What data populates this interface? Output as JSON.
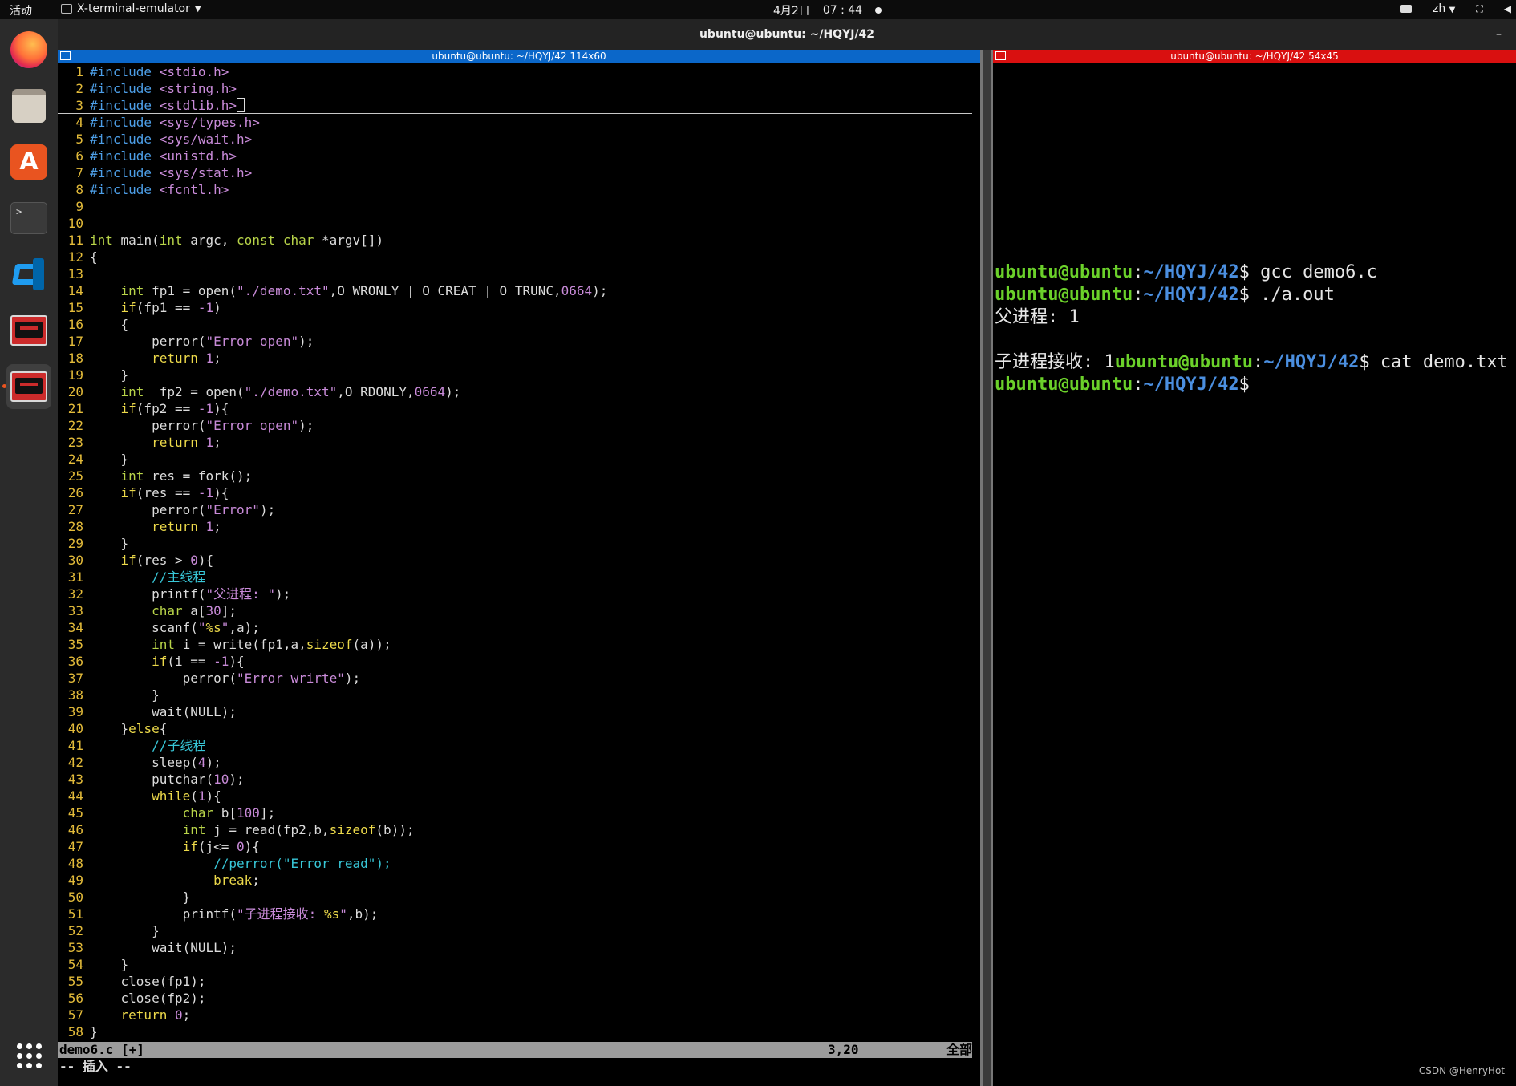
{
  "topbar": {
    "activities": "活动",
    "app_name": "X-terminal-emulator",
    "date": "4月2日",
    "time": "07 : 44",
    "input_method": "zh"
  },
  "dock": {
    "items": [
      {
        "name": "firefox-icon"
      },
      {
        "name": "files-icon"
      },
      {
        "name": "app-store-icon"
      },
      {
        "name": "terminal-icon"
      },
      {
        "name": "vscode-icon"
      },
      {
        "name": "xterm-icon"
      },
      {
        "name": "xterm-active-icon"
      }
    ],
    "show_apps_icon": "grid-icon"
  },
  "window": {
    "title": "ubuntu@ubuntu: ~/HQYJ/42",
    "minimize_glyph": "–"
  },
  "left_pane": {
    "title": "ubuntu@ubuntu: ~/HQYJ/42 114x60",
    "cursor_line": 3,
    "status": {
      "file": "demo6.c [+]",
      "position": "3,20",
      "percent": "全部"
    },
    "mode": "-- 插入 --"
  },
  "right_pane": {
    "title": "ubuntu@ubuntu: ~/HQYJ/42 54x45",
    "lines": [
      {
        "user": "ubuntu@ubuntu",
        "sep": ":",
        "path": "~/HQYJ/42",
        "prompt": "$ gcc demo6.c"
      },
      {
        "user": "ubuntu@ubuntu",
        "sep": ":",
        "path": "~/HQYJ/42",
        "prompt": "$ ./a.out"
      },
      {
        "plain": "父进程: 1"
      },
      {
        "plain": ""
      },
      {
        "prefix": "子进程接收: 1",
        "user": "ubuntu@ubuntu",
        "sep": ":",
        "path": "~/HQYJ/42",
        "prompt": "$ cat demo.txt"
      },
      {
        "user": "ubuntu@ubuntu",
        "sep": ":",
        "path": "~/HQYJ/42",
        "prompt": "$"
      }
    ]
  },
  "watermark": "CSDN @HenryHot",
  "colors": {
    "line_number": "#e3bb3a",
    "preproc": "#4d9fe8",
    "string": "#c98bd9",
    "number": "#c98bd9",
    "keyword": "#ecd94a",
    "comment": "#38c7d8",
    "type": "#b8d449",
    "plain": "#dcdcdc"
  },
  "code": [
    [
      [
        "p",
        "#include "
      ],
      [
        "s",
        "<stdio.h>"
      ]
    ],
    [
      [
        "p",
        "#include "
      ],
      [
        "s",
        "<string.h>"
      ]
    ],
    [
      [
        "p",
        "#include "
      ],
      [
        "s",
        "<stdlib.h>"
      ]
    ],
    [
      [
        "p",
        "#include "
      ],
      [
        "s",
        "<sys/types.h>"
      ]
    ],
    [
      [
        "p",
        "#include "
      ],
      [
        "s",
        "<sys/wait.h>"
      ]
    ],
    [
      [
        "p",
        "#include "
      ],
      [
        "s",
        "<unistd.h>"
      ]
    ],
    [
      [
        "p",
        "#include "
      ],
      [
        "s",
        "<sys/stat.h>"
      ]
    ],
    [
      [
        "p",
        "#include "
      ],
      [
        "s",
        "<fcntl.h>"
      ]
    ],
    [],
    [],
    [
      [
        "t",
        "int"
      ],
      [
        "x",
        " main("
      ],
      [
        "t",
        "int"
      ],
      [
        "x",
        " argc, "
      ],
      [
        "t",
        "const"
      ],
      [
        "x",
        " "
      ],
      [
        "t",
        "char"
      ],
      [
        "x",
        " *argv[])"
      ]
    ],
    [
      [
        "x",
        "{"
      ]
    ],
    [],
    [
      [
        "x",
        "    "
      ],
      [
        "t",
        "int"
      ],
      [
        "x",
        " fp1 = open("
      ],
      [
        "s",
        "\"./demo.txt\""
      ],
      [
        "x",
        ",O_WRONLY | O_CREAT | O_TRUNC,"
      ],
      [
        "n",
        "0664"
      ],
      [
        "x",
        ");"
      ]
    ],
    [
      [
        "x",
        "    "
      ],
      [
        "k",
        "if"
      ],
      [
        "x",
        "(fp1 == "
      ],
      [
        "n",
        "-1"
      ],
      [
        "x",
        ")"
      ]
    ],
    [
      [
        "x",
        "    {"
      ]
    ],
    [
      [
        "x",
        "        perror("
      ],
      [
        "s",
        "\"Error open\""
      ],
      [
        "x",
        ");"
      ]
    ],
    [
      [
        "x",
        "        "
      ],
      [
        "k",
        "return"
      ],
      [
        "x",
        " "
      ],
      [
        "n",
        "1"
      ],
      [
        "x",
        ";"
      ]
    ],
    [
      [
        "x",
        "    }"
      ]
    ],
    [
      [
        "x",
        "    "
      ],
      [
        "t",
        "int"
      ],
      [
        "x",
        "  fp2 = open("
      ],
      [
        "s",
        "\"./demo.txt\""
      ],
      [
        "x",
        ",O_RDONLY,"
      ],
      [
        "n",
        "0664"
      ],
      [
        "x",
        ");"
      ]
    ],
    [
      [
        "x",
        "    "
      ],
      [
        "k",
        "if"
      ],
      [
        "x",
        "(fp2 == "
      ],
      [
        "n",
        "-1"
      ],
      [
        "x",
        "){"
      ]
    ],
    [
      [
        "x",
        "        perror("
      ],
      [
        "s",
        "\"Error open\""
      ],
      [
        "x",
        ");"
      ]
    ],
    [
      [
        "x",
        "        "
      ],
      [
        "k",
        "return"
      ],
      [
        "x",
        " "
      ],
      [
        "n",
        "1"
      ],
      [
        "x",
        ";"
      ]
    ],
    [
      [
        "x",
        "    }"
      ]
    ],
    [
      [
        "x",
        "    "
      ],
      [
        "t",
        "int"
      ],
      [
        "x",
        " res = fork();"
      ]
    ],
    [
      [
        "x",
        "    "
      ],
      [
        "k",
        "if"
      ],
      [
        "x",
        "(res == "
      ],
      [
        "n",
        "-1"
      ],
      [
        "x",
        "){"
      ]
    ],
    [
      [
        "x",
        "        perror("
      ],
      [
        "s",
        "\"Error\""
      ],
      [
        "x",
        ");"
      ]
    ],
    [
      [
        "x",
        "        "
      ],
      [
        "k",
        "return"
      ],
      [
        "x",
        " "
      ],
      [
        "n",
        "1"
      ],
      [
        "x",
        ";"
      ]
    ],
    [
      [
        "x",
        "    }"
      ]
    ],
    [
      [
        "x",
        "    "
      ],
      [
        "k",
        "if"
      ],
      [
        "x",
        "(res > "
      ],
      [
        "n",
        "0"
      ],
      [
        "x",
        "){"
      ]
    ],
    [
      [
        "x",
        "        "
      ],
      [
        "c",
        "//主线程"
      ]
    ],
    [
      [
        "x",
        "        printf("
      ],
      [
        "s",
        "\"父进程: \""
      ],
      [
        "x",
        ");"
      ]
    ],
    [
      [
        "x",
        "        "
      ],
      [
        "t",
        "char"
      ],
      [
        "x",
        " a["
      ],
      [
        "n",
        "30"
      ],
      [
        "x",
        "];"
      ]
    ],
    [
      [
        "x",
        "        scanf("
      ],
      [
        "s",
        "\""
      ],
      [
        "k",
        "%s"
      ],
      [
        "s",
        "\""
      ],
      [
        "x",
        ",a);"
      ]
    ],
    [
      [
        "x",
        "        "
      ],
      [
        "t",
        "int"
      ],
      [
        "x",
        " i = write(fp1,a,"
      ],
      [
        "k",
        "sizeof"
      ],
      [
        "x",
        "(a));"
      ]
    ],
    [
      [
        "x",
        "        "
      ],
      [
        "k",
        "if"
      ],
      [
        "x",
        "(i == "
      ],
      [
        "n",
        "-1"
      ],
      [
        "x",
        "){"
      ]
    ],
    [
      [
        "x",
        "            perror("
      ],
      [
        "s",
        "\"Error wrirte\""
      ],
      [
        "x",
        ");"
      ]
    ],
    [
      [
        "x",
        "        }"
      ]
    ],
    [
      [
        "x",
        "        wait(NULL);"
      ]
    ],
    [
      [
        "x",
        "    }"
      ],
      [
        "k",
        "else"
      ],
      [
        "x",
        "{"
      ]
    ],
    [
      [
        "x",
        "        "
      ],
      [
        "c",
        "//子线程"
      ]
    ],
    [
      [
        "x",
        "        sleep("
      ],
      [
        "n",
        "4"
      ],
      [
        "x",
        ");"
      ]
    ],
    [
      [
        "x",
        "        putchar("
      ],
      [
        "n",
        "10"
      ],
      [
        "x",
        ");"
      ]
    ],
    [
      [
        "x",
        "        "
      ],
      [
        "k",
        "while"
      ],
      [
        "x",
        "("
      ],
      [
        "n",
        "1"
      ],
      [
        "x",
        "){"
      ]
    ],
    [
      [
        "x",
        "            "
      ],
      [
        "t",
        "char"
      ],
      [
        "x",
        " b["
      ],
      [
        "n",
        "100"
      ],
      [
        "x",
        "];"
      ]
    ],
    [
      [
        "x",
        "            "
      ],
      [
        "t",
        "int"
      ],
      [
        "x",
        " j = read(fp2,b,"
      ],
      [
        "k",
        "sizeof"
      ],
      [
        "x",
        "(b));"
      ]
    ],
    [
      [
        "x",
        "            "
      ],
      [
        "k",
        "if"
      ],
      [
        "x",
        "(j<= "
      ],
      [
        "n",
        "0"
      ],
      [
        "x",
        "){"
      ]
    ],
    [
      [
        "x",
        "                "
      ],
      [
        "c",
        "//perror(\"Error read\");"
      ]
    ],
    [
      [
        "x",
        "                "
      ],
      [
        "k",
        "break"
      ],
      [
        "x",
        ";"
      ]
    ],
    [
      [
        "x",
        "            }"
      ]
    ],
    [
      [
        "x",
        "            printf("
      ],
      [
        "s",
        "\"子进程接收: "
      ],
      [
        "k",
        "%s"
      ],
      [
        "s",
        "\""
      ],
      [
        "x",
        ",b);"
      ]
    ],
    [
      [
        "x",
        "        }"
      ]
    ],
    [
      [
        "x",
        "        wait(NULL);"
      ]
    ],
    [
      [
        "x",
        "    }"
      ]
    ],
    [
      [
        "x",
        "    close(fp1);"
      ]
    ],
    [
      [
        "x",
        "    close(fp2);"
      ]
    ],
    [
      [
        "x",
        "    "
      ],
      [
        "k",
        "return"
      ],
      [
        "x",
        " "
      ],
      [
        "n",
        "0"
      ],
      [
        "x",
        ";"
      ]
    ],
    [
      [
        "x",
        "}"
      ]
    ]
  ]
}
